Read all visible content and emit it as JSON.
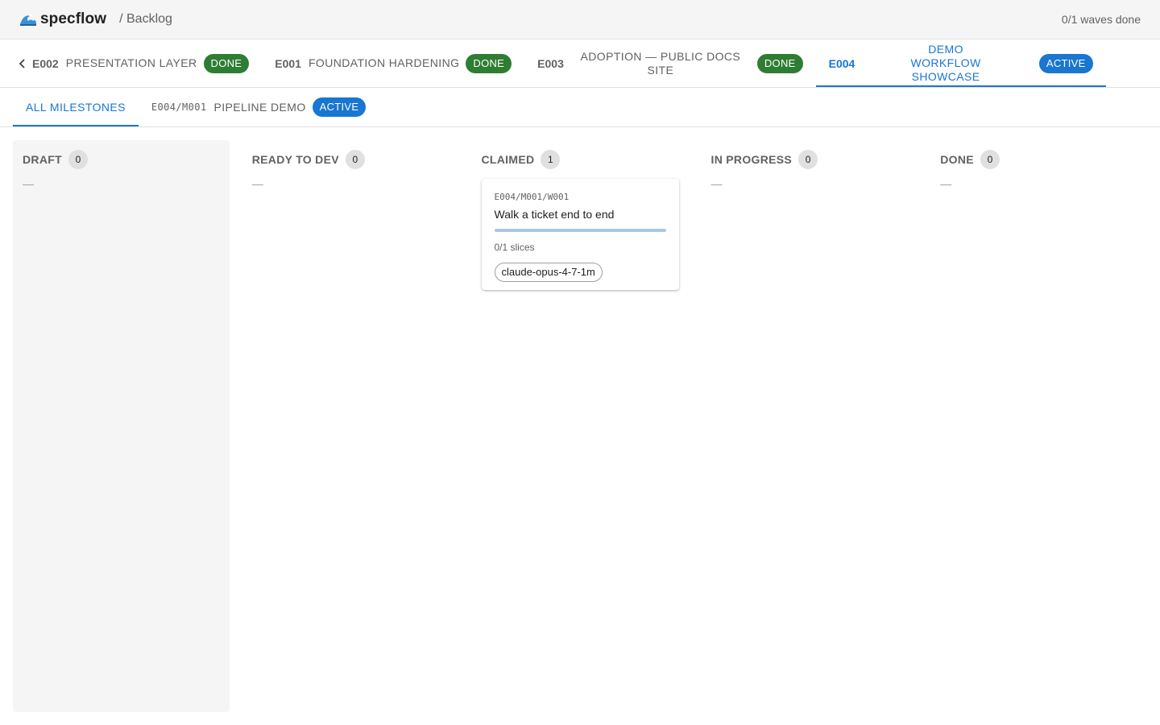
{
  "app": {
    "brand": "specflow",
    "breadcrumb": "/ Backlog",
    "waves_status": "0/1 waves done",
    "logo_icon": "wave-icon"
  },
  "epics": [
    {
      "id": "E002",
      "name": "PRESENTATION LAYER",
      "status": "DONE"
    },
    {
      "id": "E001",
      "name": "FOUNDATION HARDENING",
      "status": "DONE"
    },
    {
      "id": "E003",
      "name": "ADOPTION — PUBLIC DOCS SITE",
      "status": "DONE"
    },
    {
      "id": "E004",
      "name": "DEMO WORKFLOW SHOWCASE",
      "status": "ACTIVE",
      "selected": true
    }
  ],
  "milestone_tabs": {
    "all_label": "ALL MILESTONES",
    "milestone": {
      "id": "E004/M001",
      "name": "PIPELINE DEMO",
      "status": "ACTIVE"
    }
  },
  "columns": [
    {
      "title": "DRAFT",
      "count": "0",
      "empty": "—"
    },
    {
      "title": "READY TO DEV",
      "count": "0",
      "empty": "—"
    },
    {
      "title": "CLAIMED",
      "count": "1"
    },
    {
      "title": "IN PROGRESS",
      "count": "0",
      "empty": "—"
    },
    {
      "title": "DONE",
      "count": "0",
      "empty": "—"
    }
  ],
  "card": {
    "id": "E004/M001/W001",
    "title": "Walk a ticket end to end",
    "slices": "0/1 slices",
    "progress": 0,
    "agent": "claude-opus-4-7-1m"
  },
  "colors": {
    "accent": "#1976d2",
    "done": "#2e7d32"
  }
}
